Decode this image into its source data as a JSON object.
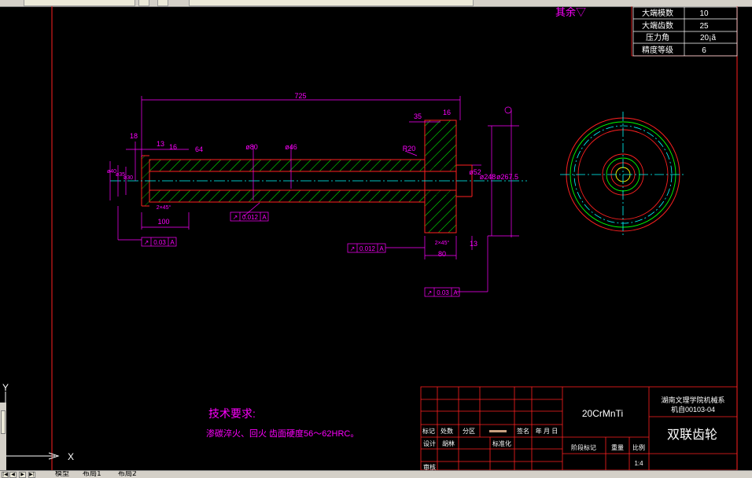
{
  "params": {
    "module_label": "大端模数",
    "module_value": "10",
    "teeth_label": "大端齿数",
    "teeth_value": "25",
    "angle_label": "压力角",
    "angle_value": "20¡ã",
    "grade_label": "精度等级",
    "grade_value": "6"
  },
  "roughness_note": "其余▽",
  "dims": {
    "d725": "725",
    "d13a": "13",
    "d16a": "16",
    "d64": "64",
    "d18": "18",
    "d80": "ø80",
    "d46": "ø46",
    "d16b": "16",
    "d35": "35",
    "d16c": "16",
    "r20": "R20",
    "d248": "ø248",
    "d2675": "ø267.5",
    "d52": "ø52",
    "d100": "100",
    "d45": "2×45°",
    "d45b": "2×45°",
    "d80b": "80",
    "d13b": "13",
    "dleft1": "ø40",
    "dleft2": "ø35",
    "dleft3": "ø30"
  },
  "tolerances": {
    "t1_value": "0.012",
    "t1_ref": "A",
    "t2_value": "0.03",
    "t2_ref": "A",
    "t3_value": "0.012",
    "t3_ref": "A",
    "t4_value": "0.03",
    "t4_ref": "A"
  },
  "tech_req": {
    "title": "技术要求:",
    "content": "渗碳淬火、回火 齿面硬度56～62HRC。"
  },
  "title_block": {
    "material": "20CrMnTi",
    "school": "湖南文理学院机械系",
    "drawing_no": "机自00103-04",
    "part_name": "双联齿轮",
    "mark": "标记",
    "count": "处数",
    "zone": "分区",
    "sign": "签名",
    "date": "年 月 日",
    "design": "设计",
    "designer": "胡林",
    "standardize": "标准化",
    "stage_mark": "阶段标记",
    "weight": "重量",
    "scale": "比例",
    "scale_value": "1:4",
    "review": "审核"
  },
  "ucs": {
    "y": "Y",
    "x": "X"
  },
  "tabs": {
    "model": "模型",
    "layout1": "布局1",
    "layout2": "布局2"
  },
  "colors": {
    "red": "#ff2020",
    "magenta": "#ff00ff",
    "green": "#00ff00",
    "cyan": "#00ffff",
    "white": "#ffffff",
    "yellow": "#ffff00"
  }
}
